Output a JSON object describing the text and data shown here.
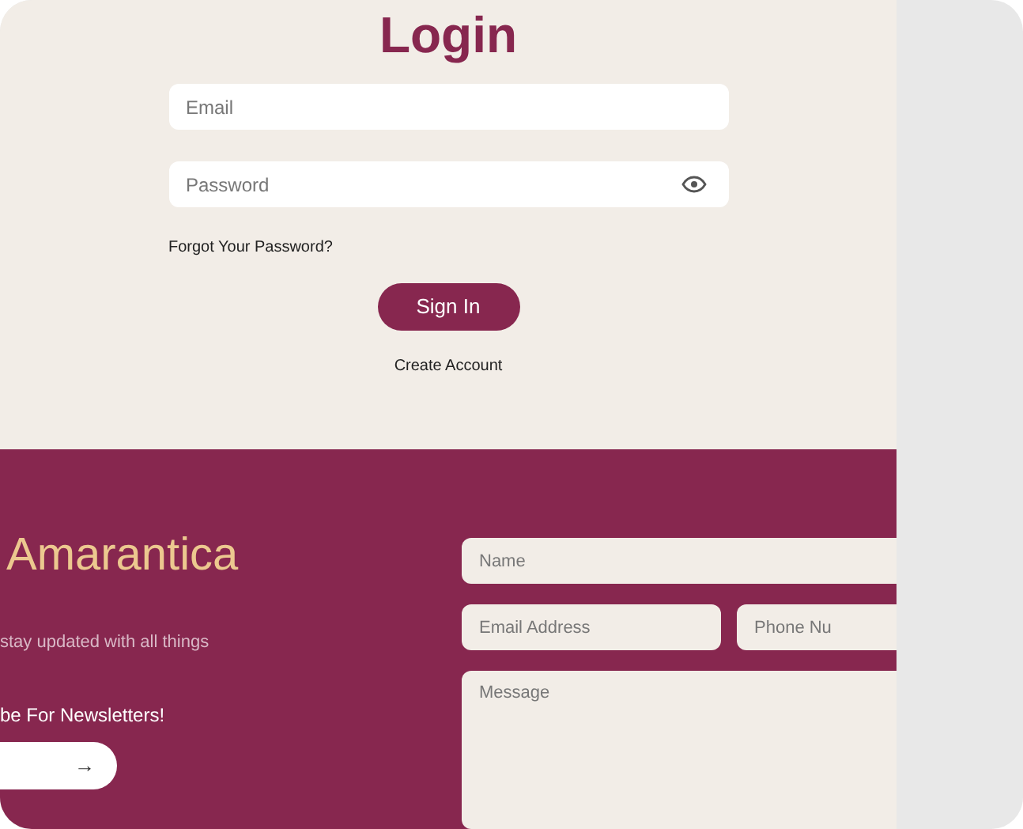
{
  "login": {
    "title": "Login",
    "email": {
      "placeholder": "Email"
    },
    "password": {
      "placeholder": "Password"
    },
    "forgot_link": "Forgot Your Password?",
    "sign_in_button": "Sign In",
    "create_account_link": "Create Account"
  },
  "footer": {
    "brand": "Amarantica",
    "tagline": "stay updated with all things",
    "subscribe_heading": "be For Newsletters!",
    "subscribe_button": "→",
    "contact_form": {
      "name": {
        "placeholder": "Name"
      },
      "email": {
        "placeholder": "Email Address"
      },
      "phone": {
        "placeholder": "Phone Nu"
      },
      "message": {
        "placeholder": "Message"
      }
    }
  }
}
